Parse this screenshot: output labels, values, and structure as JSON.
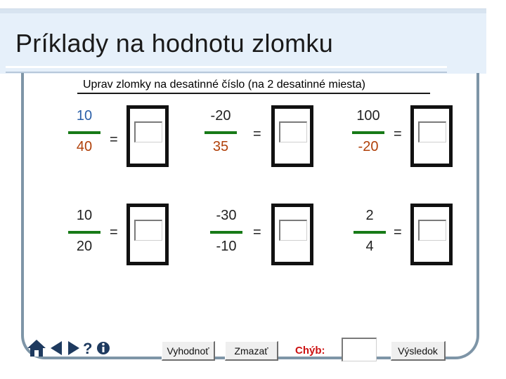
{
  "title": "Príklady na hodnotu zlomku",
  "instruction": "Uprav zlomky na desatinné číslo (na 2 desatinné miesta)",
  "colors": {
    "fraction_bar": "#177a17",
    "error_label": "#cc1111",
    "header_bg": "#e6f0fa",
    "frame": "#7e95a7"
  },
  "equals_sign": "=",
  "fractions": [
    {
      "numerator": "10",
      "denominator": "40",
      "num_color": "#2b5fa8",
      "den_color": "#b0410a"
    },
    {
      "numerator": "-20",
      "denominator": "35",
      "num_color": "#b0410a",
      "den_color": "#b0410a"
    },
    {
      "numerator": "100",
      "denominator": "-20",
      "num_color": "#222222",
      "den_color": "#b0410a"
    },
    {
      "numerator": "10",
      "denominator": "20",
      "num_color": "#2b5fa8",
      "den_color": "#b0410a"
    },
    {
      "numerator": "-30",
      "denominator": "-10",
      "num_color": "#222222",
      "den_color": "#b0410a"
    },
    {
      "numerator": "2",
      "denominator": "4",
      "num_color": "#2b5fa8",
      "den_color": "#b0410a"
    }
  ],
  "nav_icons": [
    "home-icon",
    "back-arrow-icon",
    "forward-arrow-icon",
    "help-icon",
    "info-icon"
  ],
  "buttons": {
    "evaluate": "Vyhodnoť",
    "clear": "Zmazať",
    "result": "Výsledok"
  },
  "errors": {
    "label": "Chýb:",
    "value": ""
  }
}
